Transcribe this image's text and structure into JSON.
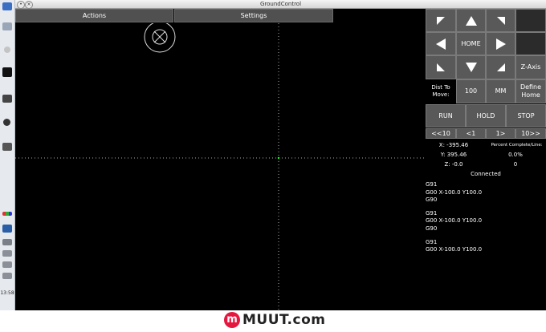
{
  "window": {
    "title": "GroundControl"
  },
  "taskbar": {
    "clock": "13:58"
  },
  "menu": {
    "actions": "Actions",
    "settings": "Settings"
  },
  "jog": {
    "home": "HOME",
    "z_axis": "Z-Axis",
    "dist_label": "Dist To Move:",
    "dist_value": "100",
    "units": "MM",
    "define_home": "Define Home"
  },
  "run": {
    "run": "RUN",
    "hold": "HOLD",
    "stop": "STOP"
  },
  "step": {
    "back10": "<<10",
    "back1": "<1",
    "fwd1": "1>",
    "fwd10": "10>>"
  },
  "position": {
    "x": "X: -395.46",
    "y": "Y: 395.46",
    "z": "Z: -0.0"
  },
  "progress": {
    "label": "Percent Complete/Line:",
    "percent": "0.0%",
    "line": "0"
  },
  "status": "Connected",
  "gcode": [
    "G91",
    "G00 X-100.0 Y100.0",
    "G90",
    "",
    "G91",
    "G00 X-100.0 Y100.0",
    "G90",
    "",
    "G91",
    "G00 X-100.0 Y100.0"
  ],
  "branding": {
    "m": "m",
    "text": "MUUT.com"
  },
  "colors": {
    "background": "#000000",
    "button": "#595959",
    "border": "#7a7a7a",
    "brand": "#e5173f"
  }
}
